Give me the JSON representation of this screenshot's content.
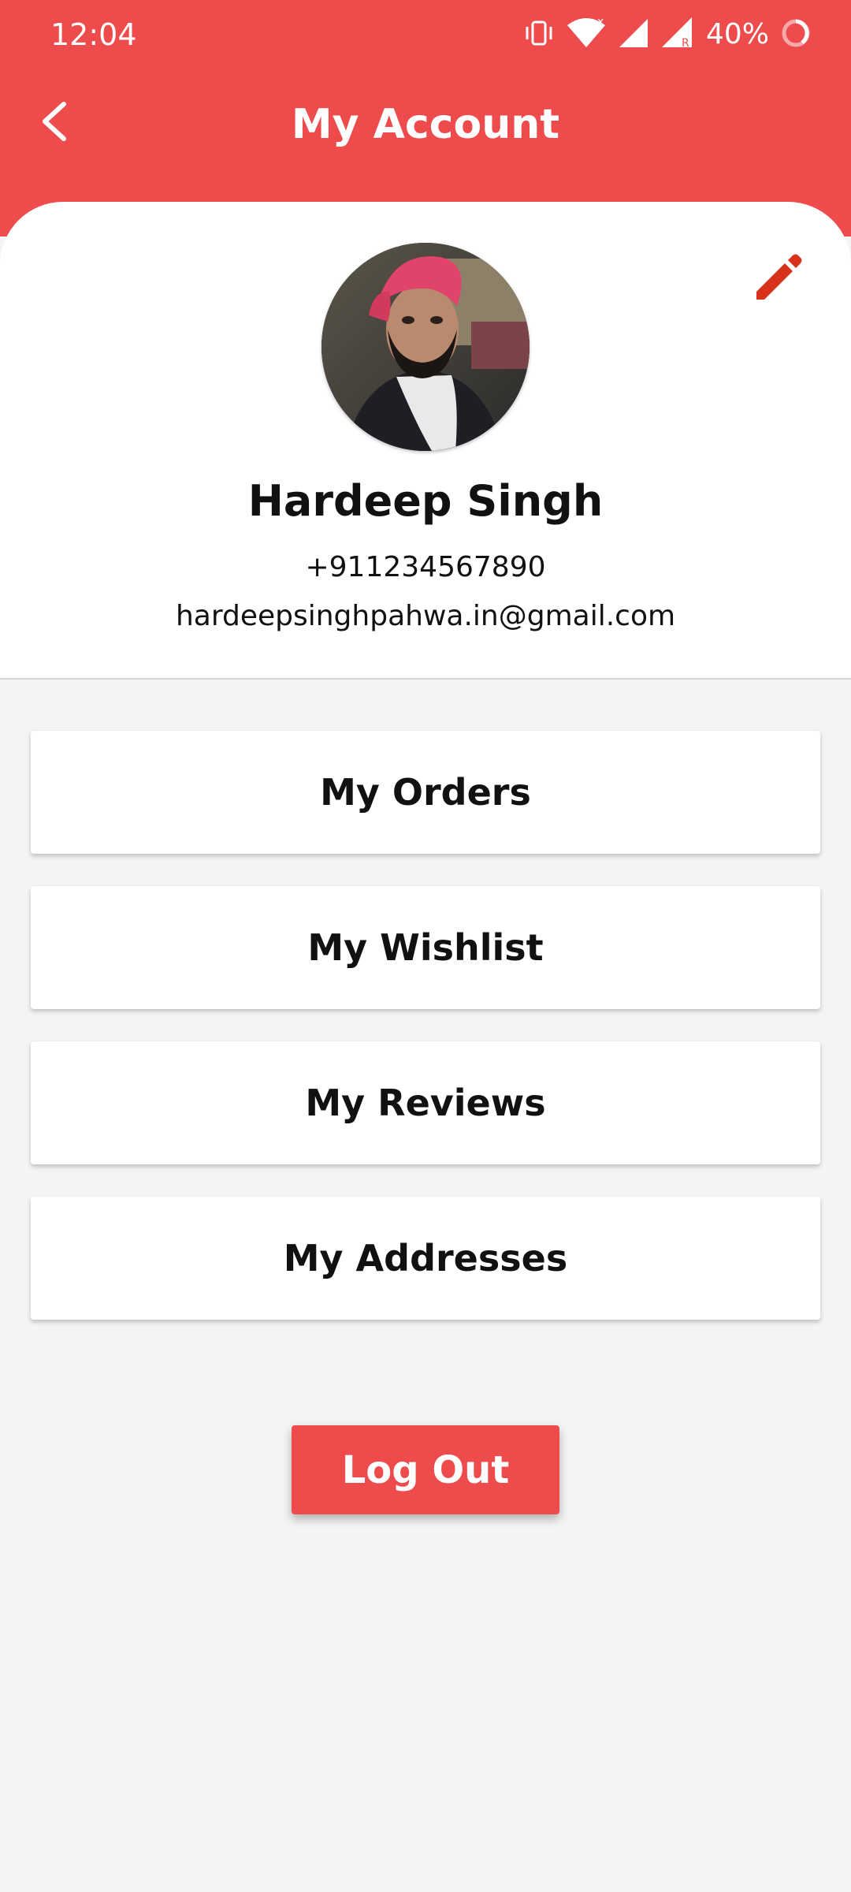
{
  "status_bar": {
    "time": "12:04",
    "battery": "40%",
    "icons": [
      "vibrate-icon",
      "wifi-icon",
      "signal-icon",
      "signal-roaming-icon",
      "battery-ring-icon"
    ]
  },
  "header": {
    "title": "My Account",
    "back_icon": "back-arrow-icon"
  },
  "profile": {
    "name": "Hardeep Singh",
    "phone": "+911234567890",
    "email": "hardeepsinghpahwa.in@gmail.com",
    "edit_icon": "pencil-icon"
  },
  "menu": {
    "items": [
      {
        "label": "My Orders"
      },
      {
        "label": "My Wishlist"
      },
      {
        "label": "My Reviews"
      },
      {
        "label": "My Addresses"
      }
    ]
  },
  "actions": {
    "logout_label": "Log Out"
  },
  "colors": {
    "brand_red": "#ed4b4c",
    "edit_icon_red": "#d8321a",
    "background": "#f4f4f4"
  }
}
